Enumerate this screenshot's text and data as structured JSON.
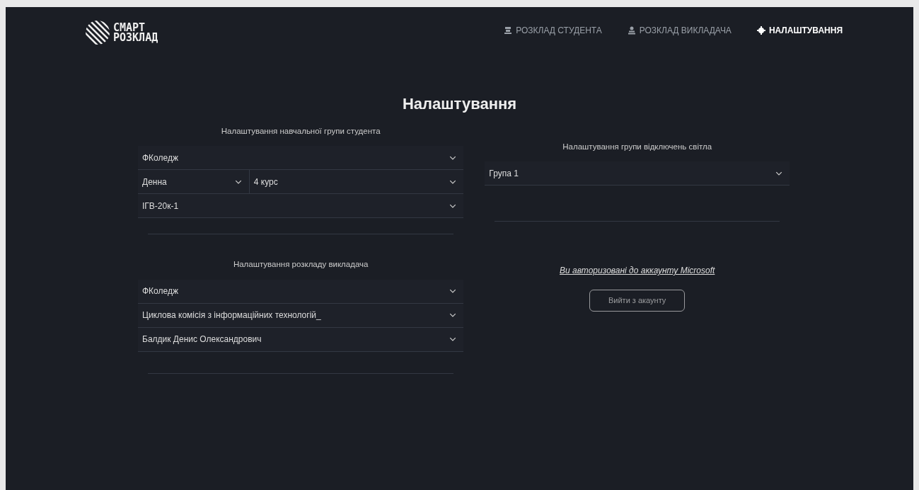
{
  "logo": {
    "line_1": "СМАРТ",
    "line_2": "РОЗКЛАД"
  },
  "nav": [
    {
      "label": "РОЗКЛАД СТУДЕНТА",
      "kind": "student",
      "selected": false
    },
    {
      "label": "РОЗКЛАД ВИКЛАДАЧА",
      "kind": "teacher",
      "selected": false
    },
    {
      "label": "НАЛАШТУВАННЯ",
      "kind": "settings",
      "selected": true
    }
  ],
  "title": "Налаштування",
  "student_group": {
    "heading": "Налаштування навчальної групи студента",
    "college": "ФКоледж",
    "form": "Денна",
    "course": "4 курс",
    "group": "ІГВ-20к-1"
  },
  "teacher": {
    "heading": "Налаштування розкладу викладача",
    "college": "ФКоледж",
    "commission": "Циклова комісія з інформаційних технологій_",
    "name": "Балдик Денис Олександрович"
  },
  "power_group": {
    "heading": "Налаштування групи відключень світла",
    "group": "Група 1"
  },
  "account": {
    "link": "Ви авторизовані до аккаунту Microsoft",
    "button": "Вийти з акаунту",
    "button_disabled": true
  }
}
